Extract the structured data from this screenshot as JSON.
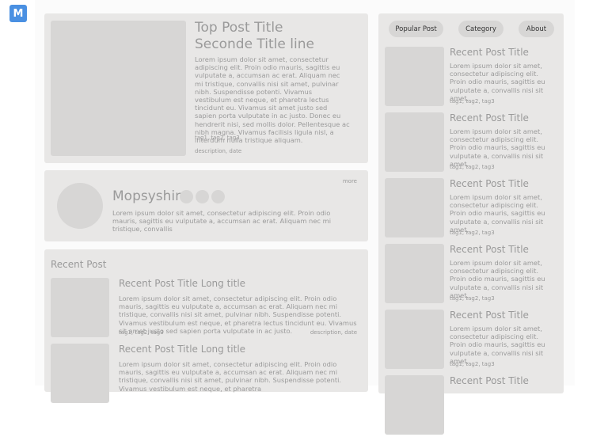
{
  "logo": {
    "letter": "M"
  },
  "top_post": {
    "title_line1": "Top Post Title",
    "title_line2": "Seconde Title line",
    "body": "Lorem ipsum dolor sit amet, consectetur adipiscing elit. Proin odio mauris, sagittis eu vulputate a, accumsan ac erat. Aliquam nec mi tristique, convallis nisi sit amet, pulvinar nibh. Suspendisse potenti. Vivamus vestibulum est neque, et pharetra lectus tincidunt eu. Vivamus sit amet justo sed sapien porta vulputate in ac justo. Donec eu hendrerit nisi, sed mollis dolor. Pellentesque ac nibh magna. Vivamus facilisis ligula nisl, a interdum nulla tristique aliquam.",
    "tags": "tag1, tag2, tag3",
    "description": "description, date"
  },
  "profile": {
    "name": "Mopsyshin",
    "more": "more",
    "bio": "Lorem ipsum dolor sit amet, consectetur adipiscing elit. Proin odio mauris, sagittis eu vulputate a, accumsan ac erat. Aliquam nec mi tristique, convallis"
  },
  "recent": {
    "heading": "Recent Post",
    "items": [
      {
        "title": "Recent Post Title Long title",
        "body": "Lorem ipsum dolor sit amet, consectetur adipiscing elit. Proin odio mauris, sagittis eu vulputate a, accumsan ac erat. Aliquam nec mi tristique, convallis nisi sit amet, pulvinar nibh. Suspendisse potenti. Vivamus vestibulum est neque, et pharetra lectus tincidunt eu. Vivamus sit amet justo sed sapien porta vulputate in ac justo.",
        "tags": "tag1, tag2, tag3",
        "description": "description, date"
      },
      {
        "title": "Recent Post Title Long title",
        "body": "Lorem ipsum dolor sit amet, consectetur adipiscing elit. Proin odio mauris, sagittis eu vulputate a, accumsan ac erat. Aliquam nec mi tristique, convallis nisi sit amet, pulvinar nibh. Suspendisse potenti. Vivamus vestibulum est neque, et pharetra",
        "tags": "",
        "description": ""
      }
    ]
  },
  "nav": {
    "popular": "Popular Post",
    "category": "Category",
    "about": "About"
  },
  "side_posts": [
    {
      "title": "Recent Post Title",
      "body": "Lorem ipsum dolor sit amet, consectetur adipiscing elit. Proin odio mauris, sagittis eu vulputate a, convallis nisi sit amet,",
      "tags": "tag1, tag2, tag3"
    },
    {
      "title": "Recent Post Title",
      "body": "Lorem ipsum dolor sit amet, consectetur adipiscing elit. Proin odio mauris, sagittis eu vulputate a, convallis nisi sit amet,",
      "tags": "tag1, tag2, tag3"
    },
    {
      "title": "Recent Post Title",
      "body": "Lorem ipsum dolor sit amet, consectetur adipiscing elit. Proin odio mauris, sagittis eu vulputate a, convallis nisi sit amet,",
      "tags": "tag1, tag2, tag3"
    },
    {
      "title": "Recent Post Title",
      "body": "Lorem ipsum dolor sit amet, consectetur adipiscing elit. Proin odio mauris, sagittis eu vulputate a, convallis nisi sit amet,",
      "tags": "tag1, tag2, tag3"
    },
    {
      "title": "Recent Post Title",
      "body": "Lorem ipsum dolor sit amet, consectetur adipiscing elit. Proin odio mauris, sagittis eu vulputate a, convallis nisi sit amet,",
      "tags": "tag1, tag2, tag3"
    },
    {
      "title": "Recent Post Title",
      "body": "",
      "tags": ""
    }
  ],
  "colors": {
    "logo": "#4a90e2",
    "card": "#e8e7e6",
    "placeholder": "#d7d6d5",
    "text": "#9a9a9a"
  }
}
